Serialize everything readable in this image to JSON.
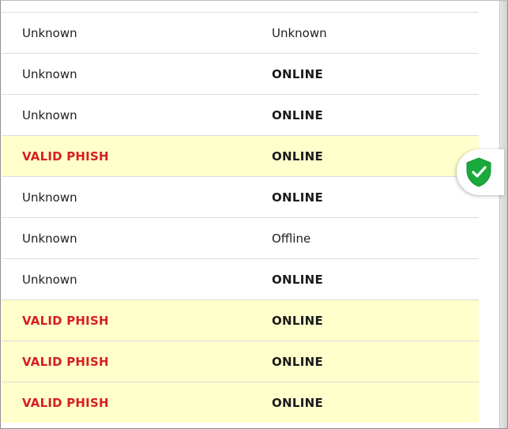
{
  "rows": [
    {
      "status": "Unknown",
      "state": "Unknown",
      "status_type": "unknown",
      "state_type": "plain",
      "highlight": false
    },
    {
      "status": "Unknown",
      "state": "ONLINE",
      "status_type": "unknown",
      "state_type": "online",
      "highlight": false
    },
    {
      "status": "Unknown",
      "state": "ONLINE",
      "status_type": "unknown",
      "state_type": "online",
      "highlight": false
    },
    {
      "status": "VALID PHISH",
      "state": "ONLINE",
      "status_type": "phish",
      "state_type": "online",
      "highlight": true
    },
    {
      "status": "Unknown",
      "state": "ONLINE",
      "status_type": "unknown",
      "state_type": "online",
      "highlight": false
    },
    {
      "status": "Unknown",
      "state": "Offline",
      "status_type": "unknown",
      "state_type": "plain",
      "highlight": false
    },
    {
      "status": "Unknown",
      "state": "ONLINE",
      "status_type": "unknown",
      "state_type": "online",
      "highlight": false
    },
    {
      "status": "VALID PHISH",
      "state": "ONLINE",
      "status_type": "phish",
      "state_type": "online",
      "highlight": true
    },
    {
      "status": "VALID PHISH",
      "state": "ONLINE",
      "status_type": "phish",
      "state_type": "online",
      "highlight": true
    },
    {
      "status": "VALID PHISH",
      "state": "ONLINE",
      "status_type": "phish",
      "state_type": "online",
      "highlight": true
    }
  ],
  "shield_badge": {
    "icon": "shield-check-icon",
    "color": "#1aaa3c"
  },
  "colors": {
    "phish": "#d61f1f",
    "highlight_bg": "#ffffcc"
  }
}
